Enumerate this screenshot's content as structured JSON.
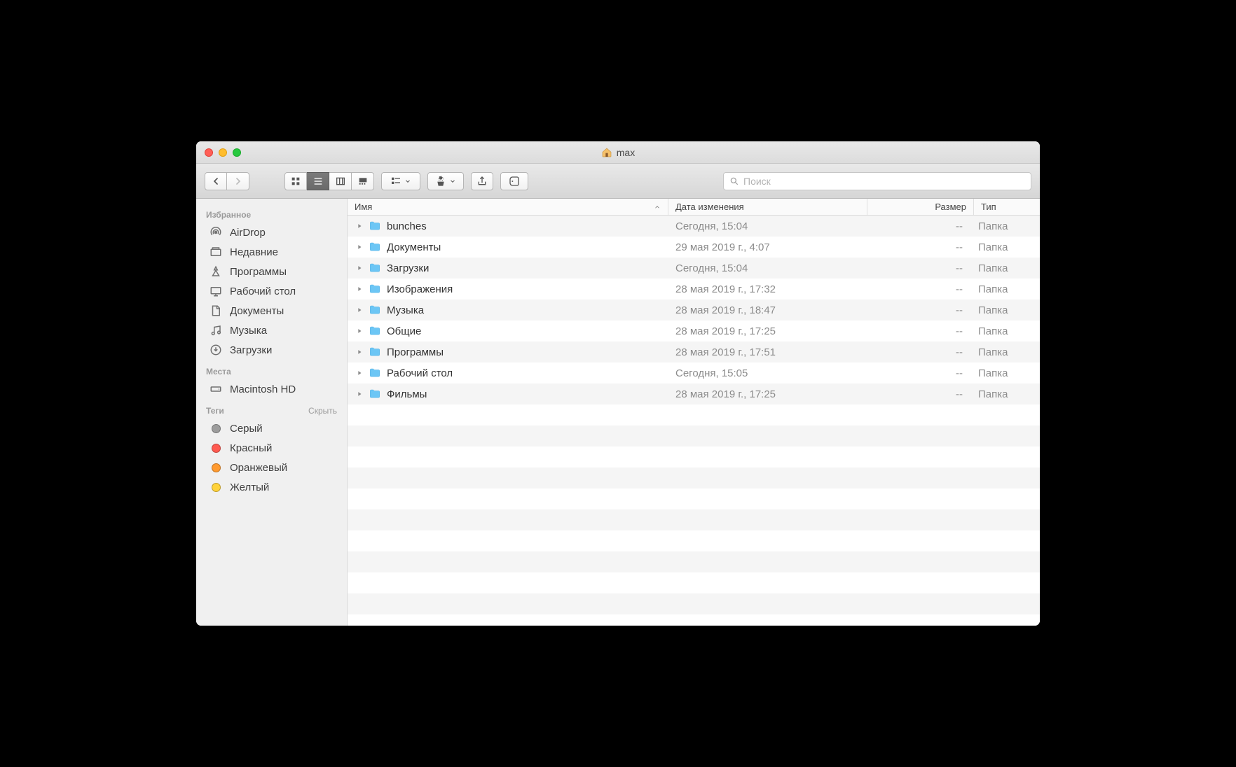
{
  "window": {
    "title": "max"
  },
  "search": {
    "placeholder": "Поиск"
  },
  "sidebar": {
    "favorites": {
      "header": "Избранное",
      "items": [
        {
          "label": "AirDrop"
        },
        {
          "label": "Недавние"
        },
        {
          "label": "Программы"
        },
        {
          "label": "Рабочий стол"
        },
        {
          "label": "Документы"
        },
        {
          "label": "Музыка"
        },
        {
          "label": "Загрузки"
        }
      ]
    },
    "locations": {
      "header": "Места",
      "items": [
        {
          "label": "Macintosh HD"
        }
      ]
    },
    "tags": {
      "header": "Теги",
      "hide": "Скрыть",
      "items": [
        {
          "label": "Серый",
          "color": "#9c9c9c"
        },
        {
          "label": "Красный",
          "color": "#ff5a50"
        },
        {
          "label": "Оранжевый",
          "color": "#ff9a2f"
        },
        {
          "label": "Желтый",
          "color": "#ffd23a"
        }
      ]
    }
  },
  "columns": {
    "name": "Имя",
    "date": "Дата изменения",
    "size": "Размер",
    "kind": "Тип"
  },
  "files": [
    {
      "name": "bunches",
      "date": "Сегодня, 15:04",
      "size": "--",
      "kind": "Папка"
    },
    {
      "name": "Документы",
      "date": "29 мая 2019 г., 4:07",
      "size": "--",
      "kind": "Папка"
    },
    {
      "name": "Загрузки",
      "date": "Сегодня, 15:04",
      "size": "--",
      "kind": "Папка"
    },
    {
      "name": "Изображения",
      "date": "28 мая 2019 г., 17:32",
      "size": "--",
      "kind": "Папка"
    },
    {
      "name": "Музыка",
      "date": "28 мая 2019 г., 18:47",
      "size": "--",
      "kind": "Папка"
    },
    {
      "name": "Общие",
      "date": "28 мая 2019 г., 17:25",
      "size": "--",
      "kind": "Папка"
    },
    {
      "name": "Программы",
      "date": "28 мая 2019 г., 17:51",
      "size": "--",
      "kind": "Папка"
    },
    {
      "name": "Рабочий стол",
      "date": "Сегодня, 15:05",
      "size": "--",
      "kind": "Папка"
    },
    {
      "name": "Фильмы",
      "date": "28 мая 2019 г., 17:25",
      "size": "--",
      "kind": "Папка"
    }
  ]
}
